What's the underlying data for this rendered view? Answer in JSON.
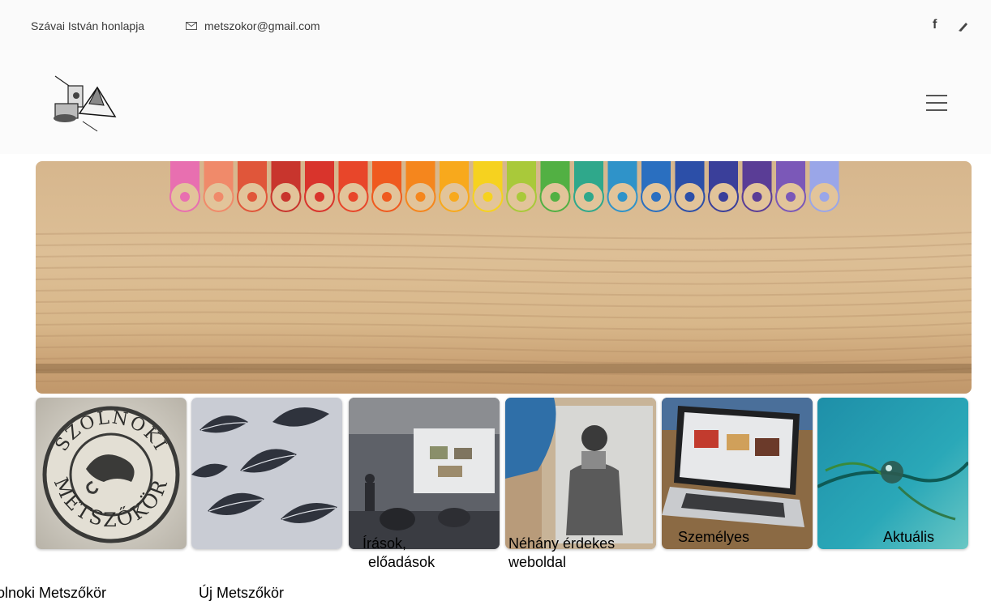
{
  "topbar": {
    "site_title": "Szávai István honlapja",
    "email": "metszokor@gmail.com",
    "social": [
      "f"
    ]
  },
  "tiles": [
    {
      "label_lines": [
        "olnoki Metszőkör"
      ],
      "seal_text_top": "SZOLNOKI",
      "seal_text_bottom": "METSZŐKÖR"
    },
    {
      "label_lines": [
        "Új Metszőkör"
      ]
    },
    {
      "label_lines": [
        "Írások,",
        "előadások"
      ]
    },
    {
      "label_lines": [
        "Néhány érdekes",
        "weboldal"
      ]
    },
    {
      "label_lines": [
        "Személyes"
      ]
    },
    {
      "label_lines": [
        "Aktuális"
      ]
    }
  ],
  "colors": {
    "pencils": [
      "#e86fb0",
      "#f08a6a",
      "#e0563a",
      "#c8352d",
      "#d9342c",
      "#e8462a",
      "#ef5a1f",
      "#f5861d",
      "#f8a91c",
      "#f6d21f",
      "#a9c93a",
      "#52b043",
      "#2fa88b",
      "#2f93c9",
      "#2a6fc0",
      "#2c4fa8",
      "#3a3f9a",
      "#5a3d96",
      "#7b58b8",
      "#9aa6e8"
    ],
    "wood": "#d8b88d"
  }
}
